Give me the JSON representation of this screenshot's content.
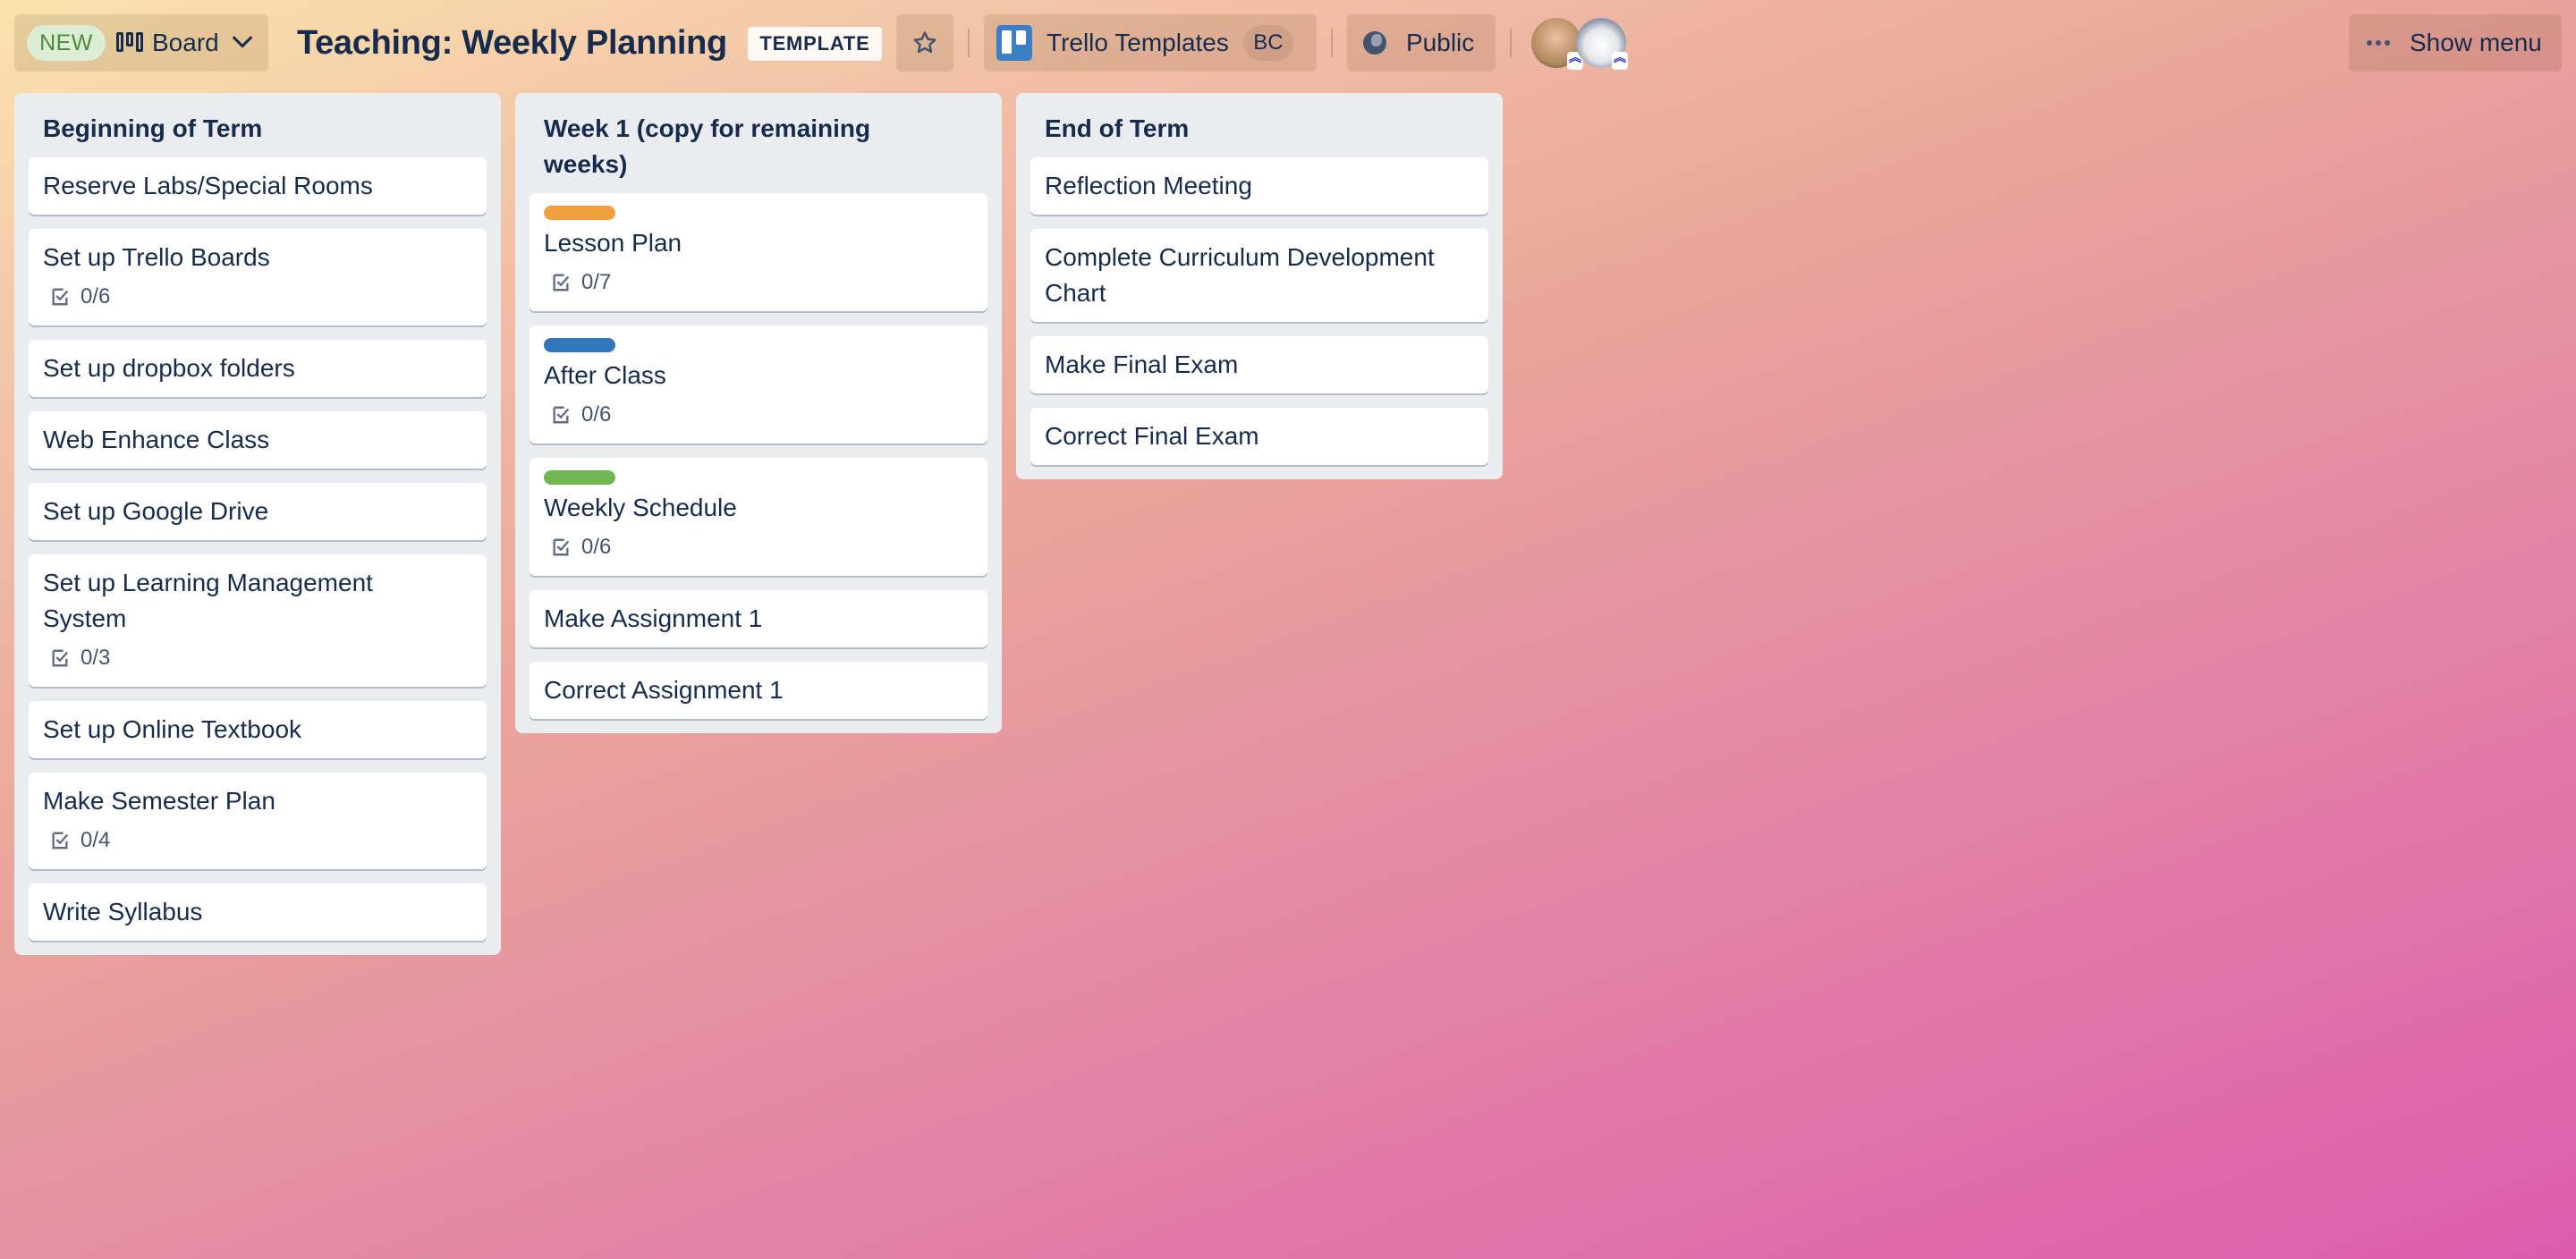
{
  "header": {
    "new_badge": "NEW",
    "view_label": "Board",
    "board_title": "Teaching: Weekly Planning",
    "template_badge": "TEMPLATE",
    "workspace_name": "Trello Templates",
    "workspace_badge": "BC",
    "visibility_label": "Public",
    "show_menu_label": "Show menu",
    "icons": {
      "view": "board-columns-icon",
      "dropdown": "chevron-down-icon",
      "star": "star-outline-icon",
      "workspace": "trello-logo-icon",
      "visibility": "globe-icon",
      "menu": "ellipsis-icon"
    },
    "members": [
      {
        "name": "member-photo",
        "admin_marker": "︽"
      },
      {
        "name": "member-husky",
        "admin_marker": "︽"
      }
    ]
  },
  "colors": {
    "label_orange": "#f2a03d",
    "label_blue": "#3277bc",
    "label_green": "#70b652",
    "text_primary": "#172b4d",
    "list_background": "#ebecf0"
  },
  "lists": [
    {
      "title": "Beginning of Term",
      "cards": [
        {
          "title": "Reserve Labs/Special Rooms"
        },
        {
          "title": "Set up Trello Boards",
          "checklist": "0/6"
        },
        {
          "title": "Set up dropbox folders"
        },
        {
          "title": "Web Enhance Class"
        },
        {
          "title": "Set up Google Drive"
        },
        {
          "title": "Set up Learning Management System",
          "checklist": "0/3"
        },
        {
          "title": "Set up Online Textbook"
        },
        {
          "title": "Make Semester Plan",
          "checklist": "0/4"
        },
        {
          "title": "Write Syllabus"
        }
      ]
    },
    {
      "title": "Week 1 (copy for remaining weeks)",
      "cards": [
        {
          "title": "Lesson Plan",
          "label_color": "#f2a03d",
          "checklist": "0/7"
        },
        {
          "title": "After Class",
          "label_color": "#3277bc",
          "checklist": "0/6"
        },
        {
          "title": "Weekly Schedule",
          "label_color": "#70b652",
          "checklist": "0/6"
        },
        {
          "title": "Make Assignment 1"
        },
        {
          "title": "Correct Assignment 1"
        }
      ]
    },
    {
      "title": "End of Term",
      "cards": [
        {
          "title": "Reflection Meeting"
        },
        {
          "title": "Complete Curriculum Development Chart"
        },
        {
          "title": "Make Final Exam"
        },
        {
          "title": "Correct Final Exam"
        }
      ]
    }
  ]
}
